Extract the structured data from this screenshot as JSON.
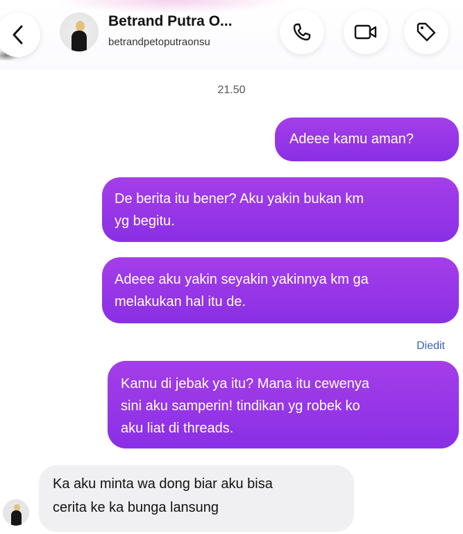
{
  "header": {
    "name": "Betrand  Putra O...",
    "username": "betrandpetoputraonsu"
  },
  "icons": {
    "back": "chevron-left-icon",
    "call": "phone-icon",
    "video": "video-camera-icon",
    "tag": "tag-icon"
  },
  "colors": {
    "outgoing_bubble": "#9a38e8",
    "incoming_bubble": "#f0f0f2",
    "edited_label": "#3a60b8"
  },
  "chat": {
    "timestamp": "21.50",
    "outgoing": [
      {
        "lines": [
          "Adeee kamu aman?"
        ]
      },
      {
        "lines": [
          "De berita itu bener? Aku yakin bukan km",
          "yg begitu."
        ]
      },
      {
        "lines": [
          "Adeee aku yakin seyakin yakinnya km ga",
          "melakukan hal itu de."
        ]
      },
      {
        "lines": [
          "Kamu di jebak ya itu? Mana itu cewenya",
          "sini aku samperin! tindikan yg robek ko",
          "aku liat di threads."
        ]
      }
    ],
    "edited_label": "Diedit",
    "incoming": [
      {
        "lines": [
          "Ka aku minta wa dong biar aku bisa",
          "cerita ke ka bunga lansung"
        ]
      }
    ]
  }
}
